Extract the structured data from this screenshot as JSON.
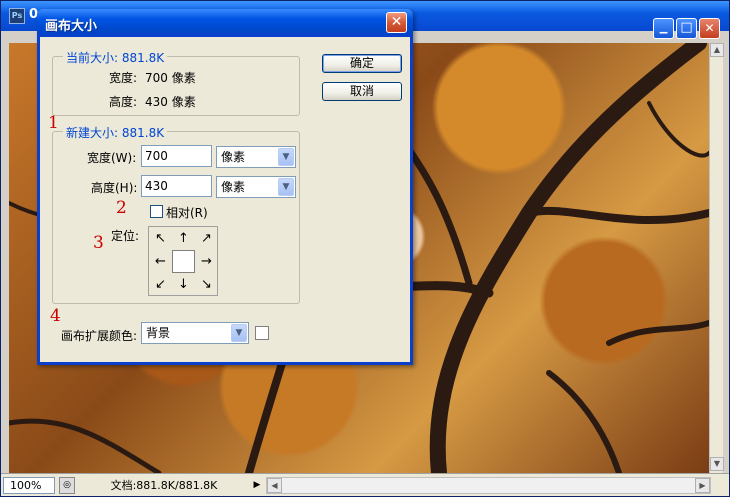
{
  "image_window": {
    "title_partial": "0",
    "app_icon": "Ps",
    "minimize_glyph": "▁",
    "maximize_glyph": "□",
    "close_glyph": "✕",
    "status": {
      "zoom": "100%",
      "doc_info": "文档:881.8K/881.8K",
      "arrow": "▶"
    },
    "scroll_up": "▲",
    "scroll_down": "▼",
    "scroll_left": "◀",
    "scroll_right": "▶"
  },
  "dialog": {
    "title": "画布大小",
    "close_glyph": "✕",
    "current_size": {
      "legend": "当前大小: 881.8K",
      "width_label": "宽度:",
      "width_value": "700 像素",
      "height_label": "高度:",
      "height_value": "430 像素"
    },
    "new_size": {
      "legend": "新建大小: 881.8K",
      "width_label": "宽度(W):",
      "width_value": "700",
      "width_unit": "像素",
      "height_label": "高度(H):",
      "height_value": "430",
      "height_unit": "像素",
      "relative_label": "相对(R)",
      "relative_checked": false,
      "anchor_label": "定位:"
    },
    "anchor_arrows": [
      "↖",
      "↑",
      "↗",
      "←",
      "",
      "→",
      "↙",
      "↓",
      "↘"
    ],
    "extension_color_label": "画布扩展颜色:",
    "extension_color_value": "背景",
    "ok_button": "确定",
    "cancel_button": "取消",
    "annotations": [
      "1",
      "2",
      "3",
      "4"
    ],
    "dropdown_glyph": "▼"
  }
}
